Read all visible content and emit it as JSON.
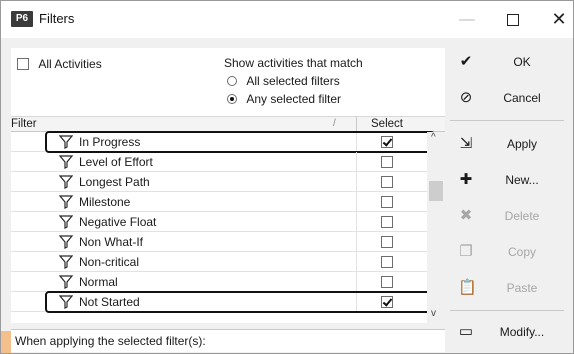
{
  "window": {
    "app_badge": "P6",
    "title": "Filters",
    "min_glyph": "—",
    "close_glyph": "✕"
  },
  "options": {
    "all_activities_label": "All Activities",
    "all_activities_checked": false,
    "show_label": "Show activities that match",
    "radio_all_label": "All selected filters",
    "radio_any_label": "Any selected filter",
    "selected_mode": "any"
  },
  "grid": {
    "header_filter": "Filter",
    "header_sort_glyph": "/",
    "header_select": "Select",
    "rows": [
      {
        "name": "In Progress",
        "selected": true,
        "highlighted": true
      },
      {
        "name": "Level of Effort",
        "selected": false,
        "highlighted": false
      },
      {
        "name": "Longest Path",
        "selected": false,
        "highlighted": false
      },
      {
        "name": "Milestone",
        "selected": false,
        "highlighted": false
      },
      {
        "name": "Negative Float",
        "selected": false,
        "highlighted": false
      },
      {
        "name": "Non What-If",
        "selected": false,
        "highlighted": false
      },
      {
        "name": "Non-critical",
        "selected": false,
        "highlighted": false
      },
      {
        "name": "Normal",
        "selected": false,
        "highlighted": false
      },
      {
        "name": "Not Started",
        "selected": true,
        "highlighted": true
      }
    ],
    "scroll_up_glyph": "^",
    "scroll_down_glyph": "v"
  },
  "footer": {
    "applying_label": "When applying the selected filter(s):"
  },
  "buttons": {
    "ok": {
      "label": "OK",
      "icon": "checkmark-icon",
      "glyph": "✔",
      "enabled": true
    },
    "cancel": {
      "label": "Cancel",
      "icon": "cancel-icon",
      "glyph": "⊘",
      "enabled": true
    },
    "apply": {
      "label": "Apply",
      "icon": "apply-icon",
      "glyph": "⇲",
      "enabled": true
    },
    "new": {
      "label": "New...",
      "icon": "new-icon",
      "glyph": "✚",
      "enabled": true
    },
    "delete": {
      "label": "Delete",
      "icon": "delete-icon",
      "glyph": "✖",
      "enabled": false
    },
    "copy": {
      "label": "Copy",
      "icon": "copy-icon",
      "glyph": "❐",
      "enabled": false
    },
    "paste": {
      "label": "Paste",
      "icon": "paste-icon",
      "glyph": "📋",
      "enabled": false
    },
    "modify": {
      "label": "Modify...",
      "icon": "modify-icon",
      "glyph": "▭",
      "enabled": true
    }
  },
  "colors": {
    "window_bg": "#f0f0f0",
    "highlight_border": "#111111",
    "disabled_text": "#a6a6a6"
  }
}
